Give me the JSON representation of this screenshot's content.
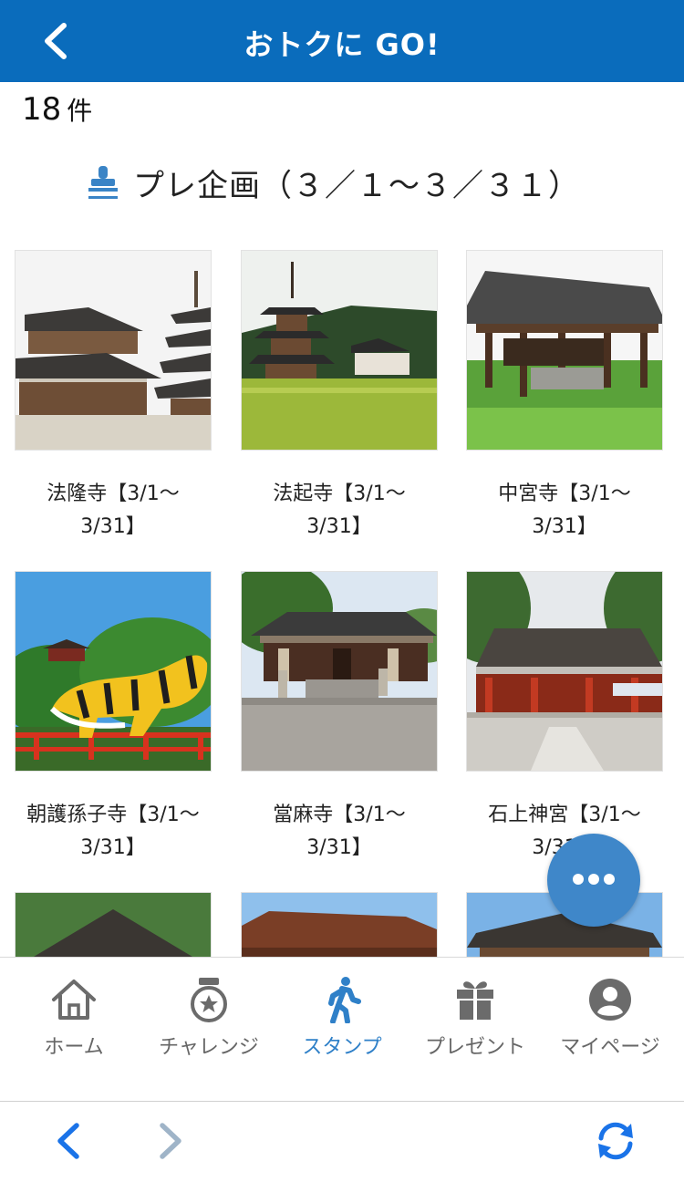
{
  "header": {
    "title": "おトクに GO!",
    "back_icon": "chevron-left-icon"
  },
  "result": {
    "count": "18",
    "unit": "件"
  },
  "campaign": {
    "icon": "stamp-icon",
    "label": "プレ企画（３／１〜３／３１）"
  },
  "spots": [
    {
      "line1": "法隆寺【3/1〜",
      "line2": "3/31】"
    },
    {
      "line1": "法起寺【3/1〜",
      "line2": "3/31】"
    },
    {
      "line1": "中宮寺【3/1〜",
      "line2": "3/31】"
    },
    {
      "line1": "朝護孫子寺【3/1〜",
      "line2": "3/31】"
    },
    {
      "line1": "當麻寺【3/1〜",
      "line2": "3/31】"
    },
    {
      "line1": "石上神宮【3/1〜",
      "line2": "3/31】"
    },
    {
      "line1": "",
      "line2": ""
    },
    {
      "line1": "",
      "line2": ""
    },
    {
      "line1": "",
      "line2": ""
    }
  ],
  "tabs": [
    {
      "label": "ホーム",
      "icon": "home-icon"
    },
    {
      "label": "チャレンジ",
      "icon": "medal-icon"
    },
    {
      "label": "スタンプ",
      "icon": "walking-person-icon"
    },
    {
      "label": "プレゼント",
      "icon": "gift-icon"
    },
    {
      "label": "マイページ",
      "icon": "user-icon"
    }
  ],
  "active_tab": "スタンプ",
  "colors": {
    "header": "#0a6cbc",
    "accent": "#2f80c8",
    "fab": "#3f87c9",
    "tab_inactive": "#666666"
  }
}
